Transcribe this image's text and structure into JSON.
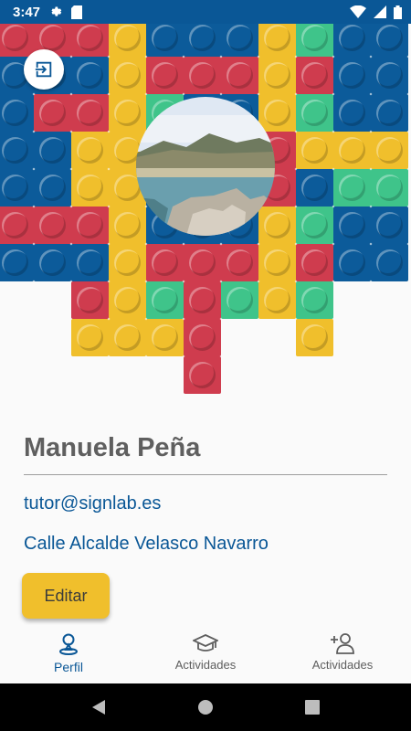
{
  "status_bar": {
    "time": "3:47",
    "left_icons": [
      "gear-icon",
      "sd-card-icon"
    ],
    "right_icons": [
      "wifi-icon",
      "signal-icon",
      "battery-icon"
    ]
  },
  "header": {
    "logout_icon": "logout-icon",
    "avatar": "beach-photo"
  },
  "profile": {
    "name": "Manuela Peña",
    "email": "tutor@signlab.es",
    "address": "Calle Alcalde Velasco Navarro",
    "edit_label": "Editar"
  },
  "bottom_nav": {
    "items": [
      {
        "label": "Perfil",
        "icon": "person-pin-icon",
        "active": true
      },
      {
        "label": "Actividades",
        "icon": "graduation-cap-icon",
        "active": false
      },
      {
        "label": "Actividades",
        "icon": "add-person-icon",
        "active": false
      }
    ]
  },
  "colors": {
    "primary": "#0a5796",
    "blue_brick": "#0c5b9a",
    "red_brick": "#cf3c4e",
    "yellow_brick": "#f0bf2c",
    "green_brick": "#3fc48a",
    "accent_button": "#f0bf2c"
  }
}
